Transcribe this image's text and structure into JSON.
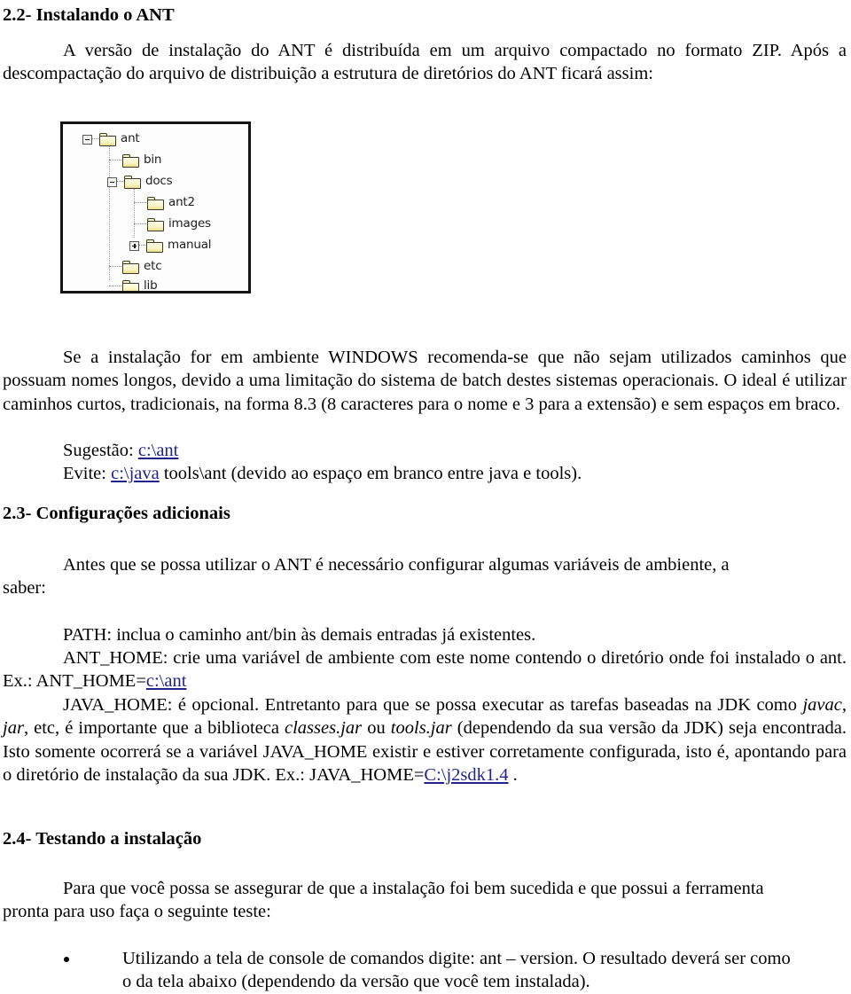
{
  "document": {
    "title": "2.2- Instalando o ANT"
  },
  "sections": {
    "s22": {
      "heading": "2.2- Instalando o ANT",
      "intro": "A versão de instalação do ANT é distribuída em um arquivo compactado no formato ZIP. Após a descompactação do arquivo de distribuição a estrutura de diretórios do ANT ficará assim:",
      "after_fig_p1_a": "Se a instalação for em ambiente WINDOWS recomenda-se que não sejam utilizados caminhos que possuam nomes longos, devido a uma limitação do sistema de batch destes sistemas operacionais. O ideal é utilizar caminhos curtos, tradicionais, na forma 8.3 (8 caracteres para o nome e 3 para a extensão) e sem espaços em braco.",
      "suggestion_label": "Sugestão:",
      "suggestion_link": "c:\\ant",
      "avoid_label": "Evite:",
      "avoid_link": "c:\\java",
      "avoid_rest": "tools\\ant (devido ao espaço em branco entre java e tools)."
    },
    "s23": {
      "heading": "2.3- Configurações adicionais",
      "intro_a": "Antes que se possa utilizar o ANT é necessário configurar algumas variáveis de ambiente, a",
      "intro_b": "saber:",
      "path_line": "PATH: inclua o caminho ant/bin às demais entradas já existentes.",
      "ant_home_a": "ANT_HOME: crie uma variável de ambiente com este nome contendo o diretório onde foi instalado o ant. Ex.: ANT_HOME=",
      "ant_home_link": "c:\\ant",
      "java_home_1": "JAVA_HOME: é opcional. Entretanto para que se possa executar as tarefas baseadas na JDK como ",
      "java_home_it1": "javac",
      "java_home_2": ", ",
      "java_home_it2": "jar",
      "java_home_3": ", etc, é importante que a biblioteca ",
      "java_home_it3": "classes.jar",
      "java_home_4": " ou ",
      "java_home_it4": "tools.jar",
      "java_home_5": " (dependendo da sua versão da JDK) seja encontrada. Isto somente ocorrerá se a variável JAVA_HOME existir e estiver corretamente configurada, isto é, apontando para o diretório de instalação da sua JDK. Ex.: JAVA_HOME=",
      "java_home_link": "C:\\j2sdk1.4",
      "java_home_end": " ."
    },
    "s24": {
      "heading": "2.4- Testando a instalação",
      "intro_a": "Para que você possa se assegurar de que a instalação foi bem sucedida e que possui a ferramenta",
      "intro_b": "pronta para uso faça o seguinte teste:",
      "bullet": "Utilizando a tela de console de comandos digite: ant – version. O resultado deverá ser como o da tela abaixo (dependendo da versão que você tem instalada)."
    }
  },
  "figure": {
    "caption": "",
    "alt": "Estrutura de diretórios do ANT",
    "colors": {
      "folder_fill": "#faf6c8",
      "folder_border": "#3c3c28",
      "frame_border": "#141414",
      "line": "#9a9a9a"
    },
    "tree": [
      {
        "label": "ant",
        "depth": 0,
        "expander": "minus"
      },
      {
        "label": "bin",
        "depth": 1,
        "expander": "none"
      },
      {
        "label": "docs",
        "depth": 1,
        "expander": "minus"
      },
      {
        "label": "ant2",
        "depth": 2,
        "expander": "none"
      },
      {
        "label": "images",
        "depth": 2,
        "expander": "none"
      },
      {
        "label": "manual",
        "depth": 2,
        "expander": "plus"
      },
      {
        "label": "etc",
        "depth": 1,
        "expander": "none"
      },
      {
        "label": "lib",
        "depth": 1,
        "expander": "none"
      }
    ]
  },
  "link_color": "#22228c"
}
